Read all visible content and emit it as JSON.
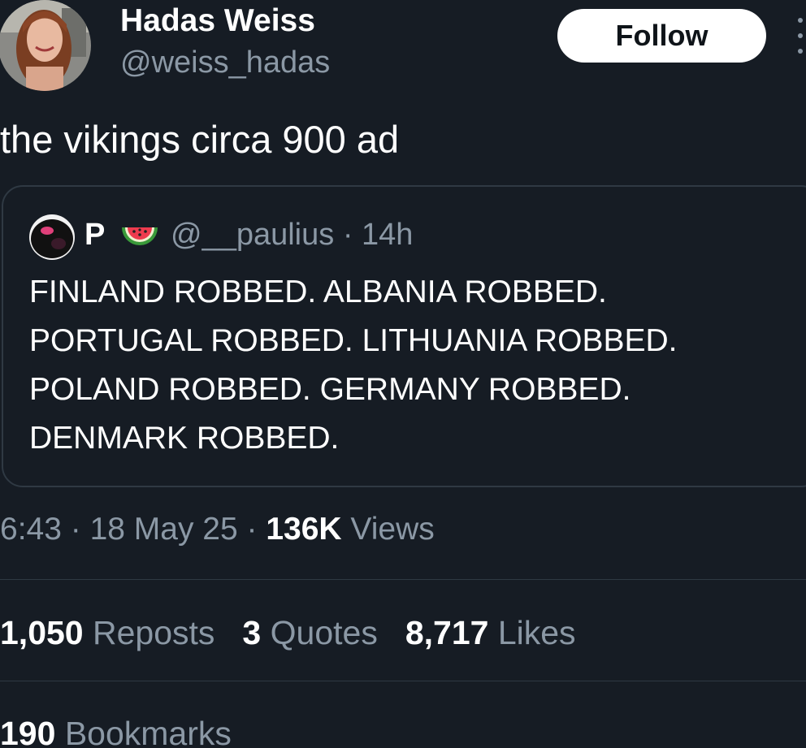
{
  "author": {
    "name": "Hadas Weiss",
    "handle": "@weiss_hadas",
    "follow_label": "Follow"
  },
  "tweet": {
    "text": "the vikings circa 900 ad"
  },
  "quote": {
    "name": "P",
    "emoji_icon": "watermelon-icon",
    "meta": "@__paulius · 14h",
    "lines": [
      "FINLAND ROBBED. ALBANIA ROBBED.",
      "PORTUGAL ROBBED. LITHUANIA ROBBED.",
      "POLAND ROBBED. GERMANY ROBBED.",
      "DENMARK ROBBED."
    ]
  },
  "meta": {
    "time_date": "6:43 · 18 May 25 · ",
    "views_count": "136K",
    "views_label": " Views"
  },
  "stats": {
    "reposts_count": "1,050",
    "reposts_label": " Reposts",
    "quotes_count": "3",
    "quotes_label": " Quotes",
    "likes_count": "8,717",
    "likes_label": " Likes",
    "bookmarks_count": "190",
    "bookmarks_label": " Bookmarks"
  },
  "colors": {
    "background": "#161c24",
    "text_primary": "#ffffff",
    "text_secondary": "#8b98a5",
    "border": "#2f3943",
    "follow_bg": "#ffffff"
  }
}
